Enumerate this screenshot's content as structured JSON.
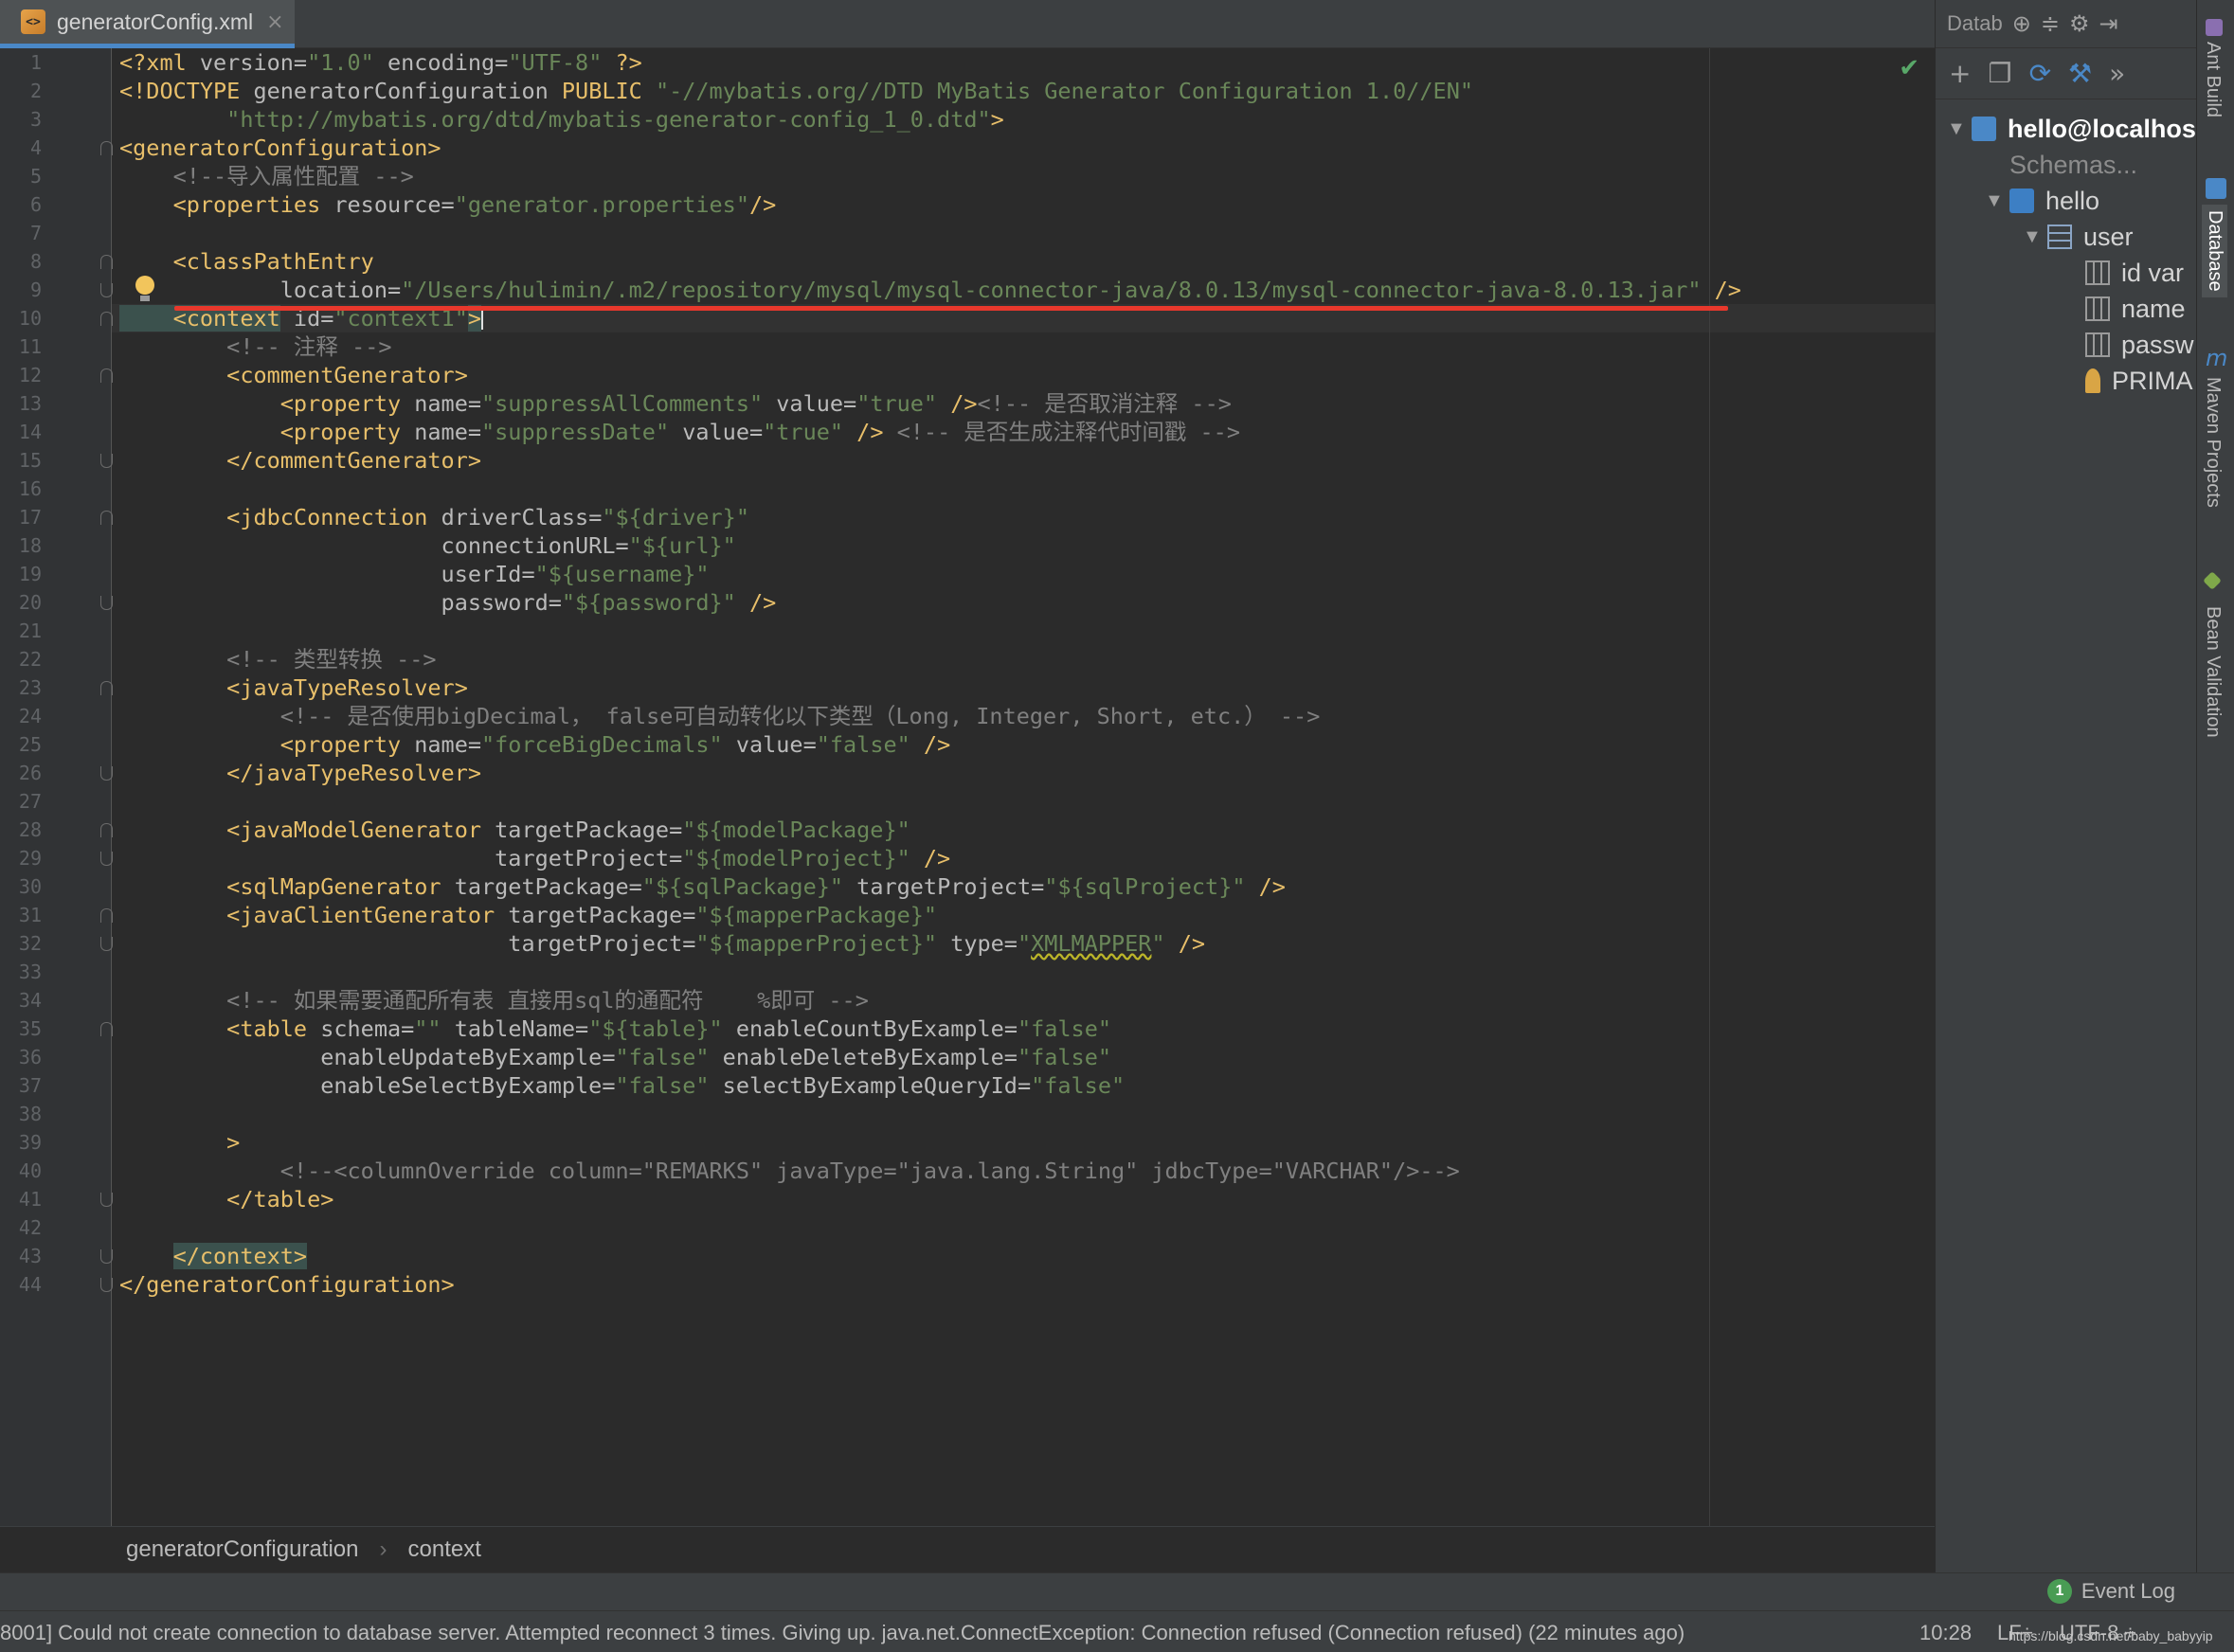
{
  "editor_tab": {
    "label": "generatorConfig.xml",
    "close_glyph": "×",
    "icon_text": "<>"
  },
  "code_lines": [
    {
      "n": "1",
      "segs": [
        [
          "tg",
          "<?xml "
        ],
        [
          "at",
          "version="
        ],
        [
          "av",
          "\"1.0\""
        ],
        [
          "at",
          " encoding="
        ],
        [
          "av",
          "\"UTF-8\""
        ],
        [
          "tg",
          " ?>"
        ]
      ]
    },
    {
      "n": "2",
      "segs": [
        [
          "tg",
          "<!DOCTYPE "
        ],
        [
          "at",
          "generatorConfiguration "
        ],
        [
          "tg",
          "PUBLIC "
        ],
        [
          "av",
          "\"-//mybatis.org//DTD MyBatis Generator Configuration 1.0//EN\""
        ]
      ]
    },
    {
      "n": "3",
      "segs": [
        [
          "av",
          "        \"http://mybatis.org/dtd/mybatis-generator-config_1_0.dtd\""
        ],
        [
          "tg",
          ">"
        ]
      ]
    },
    {
      "n": "4",
      "fold": "open",
      "segs": [
        [
          "tg",
          "<generatorConfiguration>"
        ]
      ]
    },
    {
      "n": "5",
      "segs": [
        [
          "cm",
          "    <!--导入属性配置 -->"
        ]
      ]
    },
    {
      "n": "6",
      "segs": [
        [
          "tg",
          "    <properties "
        ],
        [
          "at",
          "resource="
        ],
        [
          "av",
          "\"generator.properties\""
        ],
        [
          "tg",
          "/>"
        ]
      ]
    },
    {
      "n": "7",
      "segs": []
    },
    {
      "n": "8",
      "fold": "open",
      "segs": [
        [
          "tg",
          "    <classPathEntry"
        ]
      ]
    },
    {
      "n": "9",
      "fold": "close",
      "segs": [
        [
          "at",
          "            location="
        ],
        [
          "av",
          "\"/Users/hulimin/.m2/repository/mysql/mysql-connector-java/8.0.13/mysql-connector-java-8.0.13.jar\""
        ],
        [
          "tg",
          " />"
        ]
      ]
    },
    {
      "n": "10",
      "fold": "open",
      "segs": [
        [
          "tg-hl",
          "    <context"
        ],
        [
          "at",
          " id="
        ],
        [
          "av",
          "\"context1\""
        ],
        [
          "tg-hl",
          ">"
        ],
        [
          "caret",
          ""
        ]
      ]
    },
    {
      "n": "11",
      "segs": [
        [
          "cm",
          "        <!-- 注释 -->"
        ]
      ]
    },
    {
      "n": "12",
      "fold": "open",
      "segs": [
        [
          "tg",
          "        <commentGenerator>"
        ]
      ]
    },
    {
      "n": "13",
      "segs": [
        [
          "tg",
          "            <property "
        ],
        [
          "at",
          "name="
        ],
        [
          "av",
          "\"suppressAllComments\""
        ],
        [
          "at",
          " value="
        ],
        [
          "av",
          "\"true\""
        ],
        [
          "tg",
          " />"
        ],
        [
          "cm",
          "<!-- 是否取消注释 -->"
        ]
      ]
    },
    {
      "n": "14",
      "segs": [
        [
          "tg",
          "            <property "
        ],
        [
          "at",
          "name="
        ],
        [
          "av",
          "\"suppressDate\""
        ],
        [
          "at",
          " value="
        ],
        [
          "av",
          "\"true\""
        ],
        [
          "tg",
          " />"
        ],
        [
          "cm",
          " <!-- 是否生成注释代时间戳 -->"
        ]
      ]
    },
    {
      "n": "15",
      "fold": "close",
      "segs": [
        [
          "tg",
          "        </commentGenerator>"
        ]
      ]
    },
    {
      "n": "16",
      "segs": []
    },
    {
      "n": "17",
      "fold": "open",
      "segs": [
        [
          "tg",
          "        <jdbcConnection "
        ],
        [
          "at",
          "driverClass="
        ],
        [
          "av",
          "\"${driver}\""
        ]
      ]
    },
    {
      "n": "18",
      "segs": [
        [
          "at",
          "                        connectionURL="
        ],
        [
          "av",
          "\"${url}\""
        ]
      ]
    },
    {
      "n": "19",
      "segs": [
        [
          "at",
          "                        userId="
        ],
        [
          "av",
          "\"${username}\""
        ]
      ]
    },
    {
      "n": "20",
      "fold": "close",
      "segs": [
        [
          "at",
          "                        password="
        ],
        [
          "av",
          "\"${password}\""
        ],
        [
          "tg",
          " />"
        ]
      ]
    },
    {
      "n": "21",
      "segs": []
    },
    {
      "n": "22",
      "segs": [
        [
          "cm",
          "        <!-- 类型转换 -->"
        ]
      ]
    },
    {
      "n": "23",
      "fold": "open",
      "segs": [
        [
          "tg",
          "        <javaTypeResolver>"
        ]
      ]
    },
    {
      "n": "24",
      "segs": [
        [
          "cm",
          "            <!-- 是否使用bigDecimal， false可自动转化以下类型（Long, Integer, Short, etc.） -->"
        ]
      ]
    },
    {
      "n": "25",
      "segs": [
        [
          "tg",
          "            <property "
        ],
        [
          "at",
          "name="
        ],
        [
          "av",
          "\"forceBigDecimals\""
        ],
        [
          "at",
          " value="
        ],
        [
          "av",
          "\"false\""
        ],
        [
          "tg",
          " />"
        ]
      ]
    },
    {
      "n": "26",
      "fold": "close",
      "segs": [
        [
          "tg",
          "        </javaTypeResolver>"
        ]
      ]
    },
    {
      "n": "27",
      "segs": []
    },
    {
      "n": "28",
      "fold": "open",
      "segs": [
        [
          "tg",
          "        <javaModelGenerator "
        ],
        [
          "at",
          "targetPackage="
        ],
        [
          "av",
          "\"${modelPackage}\""
        ]
      ]
    },
    {
      "n": "29",
      "fold": "close",
      "segs": [
        [
          "at",
          "                            targetProject="
        ],
        [
          "av",
          "\"${modelProject}\""
        ],
        [
          "tg",
          " />"
        ]
      ]
    },
    {
      "n": "30",
      "segs": [
        [
          "tg",
          "        <sqlMapGenerator "
        ],
        [
          "at",
          "targetPackage="
        ],
        [
          "av",
          "\"${sqlPackage}\""
        ],
        [
          "at",
          " targetProject="
        ],
        [
          "av",
          "\"${sqlProject}\""
        ],
        [
          "tg",
          " />"
        ]
      ]
    },
    {
      "n": "31",
      "fold": "open",
      "segs": [
        [
          "tg",
          "        <javaClientGenerator "
        ],
        [
          "at",
          "targetPackage="
        ],
        [
          "av",
          "\"${mapperPackage}\""
        ]
      ]
    },
    {
      "n": "32",
      "fold": "close",
      "segs": [
        [
          "at",
          "                             targetProject="
        ],
        [
          "av",
          "\"${mapperProject}\""
        ],
        [
          "at",
          " type="
        ],
        [
          "av",
          "\""
        ],
        [
          "squig",
          "XMLMAPPER"
        ],
        [
          "av",
          "\""
        ],
        [
          "tg",
          " />"
        ]
      ]
    },
    {
      "n": "33",
      "segs": []
    },
    {
      "n": "34",
      "segs": [
        [
          "cm",
          "        <!-- 如果需要通配所有表 直接用sql的通配符    %即可 -->"
        ]
      ]
    },
    {
      "n": "35",
      "fold": "open",
      "segs": [
        [
          "tg",
          "        <table "
        ],
        [
          "at",
          "schema="
        ],
        [
          "av",
          "\"\""
        ],
        [
          "at",
          " tableName="
        ],
        [
          "av",
          "\"${table}\""
        ],
        [
          "at",
          " enableCountByExample="
        ],
        [
          "av",
          "\"false\""
        ]
      ]
    },
    {
      "n": "36",
      "segs": [
        [
          "at",
          "               enableUpdateByExample="
        ],
        [
          "av",
          "\"false\""
        ],
        [
          "at",
          " enableDeleteByExample="
        ],
        [
          "av",
          "\"false\""
        ]
      ]
    },
    {
      "n": "37",
      "segs": [
        [
          "at",
          "               enableSelectByExample="
        ],
        [
          "av",
          "\"false\""
        ],
        [
          "at",
          " selectByExampleQueryId="
        ],
        [
          "av",
          "\"false\""
        ]
      ]
    },
    {
      "n": "38",
      "segs": []
    },
    {
      "n": "39",
      "segs": [
        [
          "tg",
          "        >"
        ]
      ]
    },
    {
      "n": "40",
      "segs": [
        [
          "cm",
          "            <!--<columnOverride column=\"REMARKS\" javaType=\"java.lang.String\" jdbcType=\"VARCHAR\"/>-->"
        ]
      ]
    },
    {
      "n": "41",
      "fold": "close",
      "segs": [
        [
          "tg",
          "        </table>"
        ]
      ]
    },
    {
      "n": "42",
      "segs": []
    },
    {
      "n": "43",
      "fold": "close",
      "segs": [
        [
          "tg",
          "    "
        ],
        [
          "tg-hl",
          "</context>"
        ]
      ]
    },
    {
      "n": "44",
      "fold": "close",
      "segs": [
        [
          "tg",
          "</generatorConfiguration>"
        ]
      ]
    }
  ],
  "breadcrumb": {
    "items": [
      "generatorConfiguration",
      "context"
    ],
    "separator": "›"
  },
  "database_panel": {
    "title": "Datab",
    "tree": [
      {
        "label": "hello@localhost",
        "icon": "database-icon",
        "level": 0,
        "arrow": "▼",
        "bold": true
      },
      {
        "label": "Schemas...",
        "icon": "",
        "level": 1,
        "arrow": "",
        "muted": true
      },
      {
        "label": "hello",
        "icon": "schema-icon",
        "level": 1,
        "arrow": "▼"
      },
      {
        "label": "user",
        "icon": "table-icon",
        "level": 2,
        "arrow": "▼"
      },
      {
        "label": "id var",
        "icon": "column-key-icon",
        "level": 3,
        "arrow": ""
      },
      {
        "label": "name",
        "icon": "column-icon",
        "level": 3,
        "arrow": ""
      },
      {
        "label": "passw",
        "icon": "column-icon",
        "level": 3,
        "arrow": ""
      },
      {
        "label": "PRIMA",
        "icon": "primary-key-icon",
        "level": 3,
        "arrow": ""
      }
    ]
  },
  "side_tabs": [
    "Ant Build",
    "Database",
    "Maven Projects",
    "Bean Validation"
  ],
  "event_log": {
    "label": "Event Log",
    "count": "1"
  },
  "status": {
    "message": "8001] Could not create connection to database server. Attempted reconnect 3 times. Giving up. java.net.ConnectException: Connection refused (Connection refused) (22 minutes ago)",
    "time": "10:28",
    "line_sep": "LF÷",
    "encoding": "UTF-8 ÷",
    "watermark": "https://blog.csdn.net/baby_babyyip"
  },
  "colors": {
    "tag": "#e8bf6a",
    "attr": "#bababa",
    "value": "#6a8759",
    "comment": "#808080",
    "accent": "#4a88c7",
    "error_underline": "#e8382c"
  }
}
